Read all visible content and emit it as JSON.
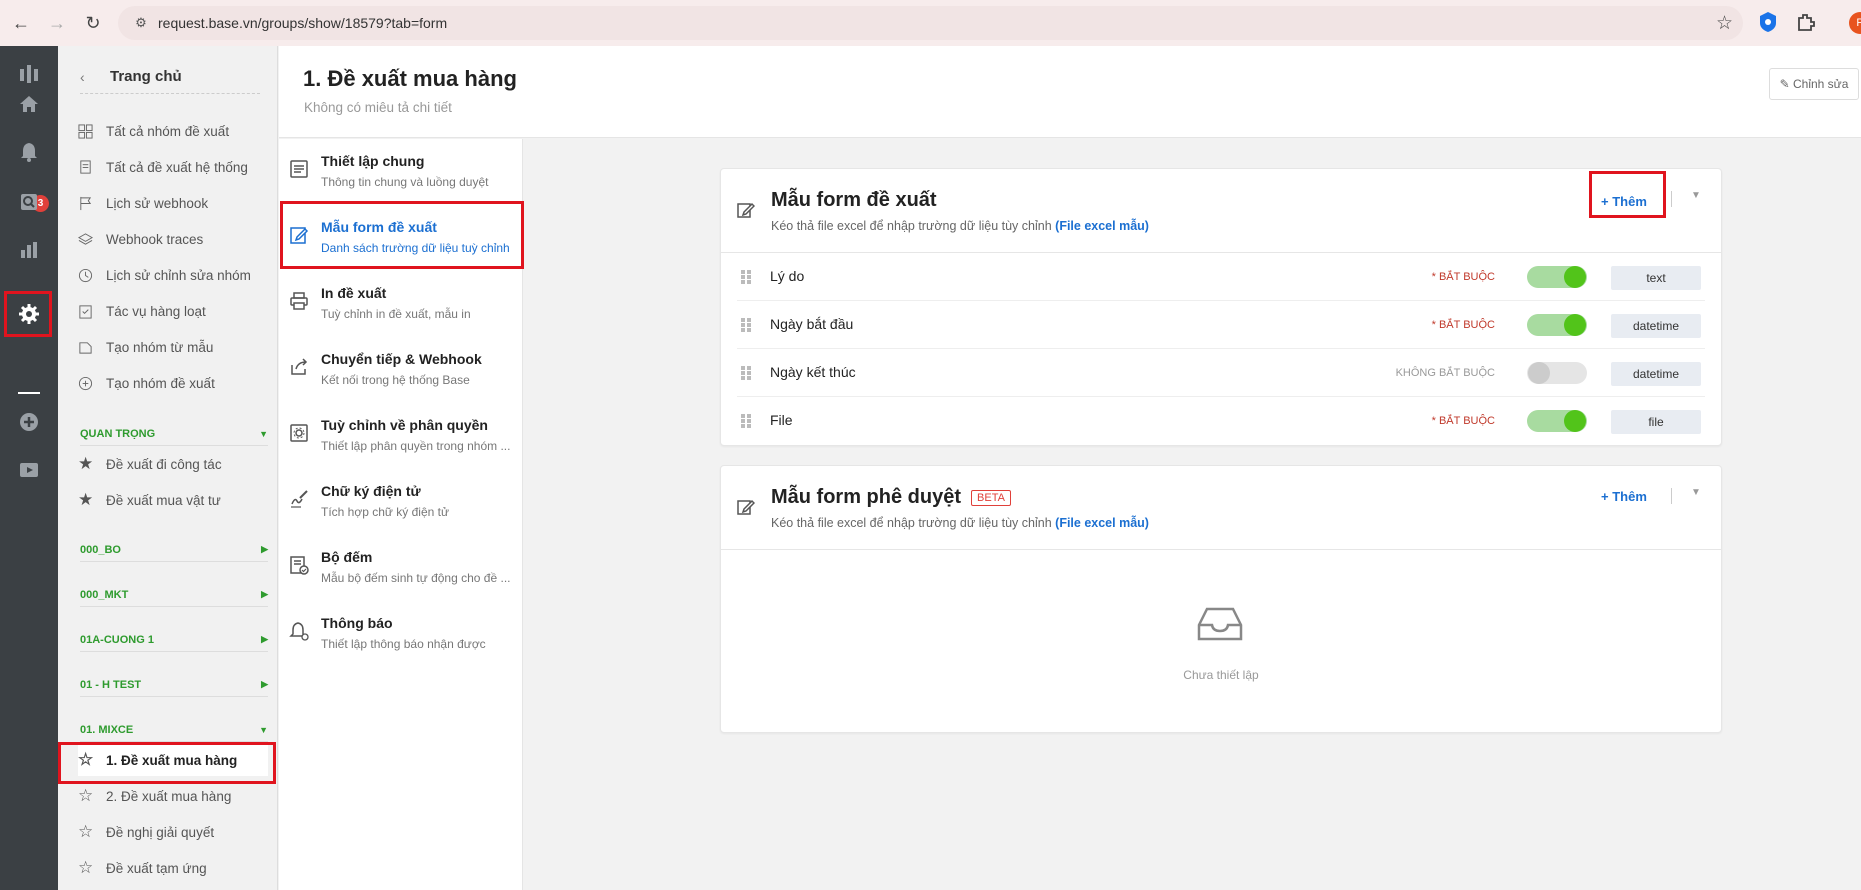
{
  "browser": {
    "url": "request.base.vn/groups/show/18579?tab=form",
    "profile_initial": "P"
  },
  "rail": {
    "notification_count": "3"
  },
  "sidebar": {
    "home_label": "Trang chủ",
    "items": [
      {
        "label": "Tất cả nhóm đề xuất",
        "icon": "grid-icon"
      },
      {
        "label": "Tất cả đề xuất hệ thống",
        "icon": "documents-icon"
      },
      {
        "label": "Lịch sử webhook",
        "icon": "flag-icon"
      },
      {
        "label": "Webhook traces",
        "icon": "layers-icon"
      },
      {
        "label": "Lịch sử chỉnh sửa nhóm",
        "icon": "clock-icon"
      },
      {
        "label": "Tác vụ hàng loạt",
        "icon": "checklist-icon"
      },
      {
        "label": "Tạo nhóm từ mẫu",
        "icon": "template-icon"
      },
      {
        "label": "Tạo nhóm đề xuất",
        "icon": "plus-circle-icon"
      }
    ],
    "sections": [
      {
        "label": "QUAN TRỌNG",
        "items": [
          "Đề xuất đi công tác",
          "Đề xuất mua vật tư"
        ]
      },
      {
        "label": "000_BO"
      },
      {
        "label": "000_MKT"
      },
      {
        "label": "01A-CUONG 1"
      },
      {
        "label": "01 - H TEST"
      },
      {
        "label": "01. MIXCE",
        "items": [
          "1. Đề xuất mua hàng",
          "2. Đề xuất mua hàng",
          "Đề nghị giải quyết",
          "Đề xuất tạm ứng"
        ]
      }
    ]
  },
  "header": {
    "title": "1. Đề xuất mua hàng",
    "subtitle": "Không có miêu tả chi tiết",
    "edit_label": "Chỉnh sửa"
  },
  "setnav": [
    {
      "title": "Thiết lập chung",
      "sub": "Thông tin chung và luồng duyệt",
      "icon": "document-lines-icon"
    },
    {
      "title": "Mẫu form đề xuất",
      "sub": "Danh sách trường dữ liệu tuỳ chỉnh",
      "icon": "edit-icon",
      "active": true
    },
    {
      "title": "In đề xuất",
      "sub": "Tuỳ chỉnh in đề xuất, mẫu in",
      "icon": "printer-icon"
    },
    {
      "title": "Chuyển tiếp & Webhook",
      "sub": "Kết nối trong hệ thống Base",
      "icon": "share-icon"
    },
    {
      "title": "Tuỳ chỉnh về phân quyền",
      "sub": "Thiết lập phân quyền trong nhóm ...",
      "icon": "settings-box-icon"
    },
    {
      "title": "Chữ ký điện tử",
      "sub": "Tích hợp chữ ký điện tử",
      "icon": "signature-icon"
    },
    {
      "title": "Bộ đếm",
      "sub": "Mẫu bộ đếm sinh tự động cho đề ...",
      "icon": "counter-icon"
    },
    {
      "title": "Thông báo",
      "sub": "Thiết lập thông báo nhận được",
      "icon": "bell-settings-icon"
    }
  ],
  "form_card": {
    "title": "Mẫu form đề xuất",
    "desc": "Kéo thả file excel để nhập trường dữ liệu tùy chỉnh",
    "link": "(File excel mẫu)",
    "add_label": "+ Thêm",
    "fields": [
      {
        "name": "Lý do",
        "required": "* BẮT BUỘC",
        "enabled": true,
        "type": "text"
      },
      {
        "name": "Ngày bắt đầu",
        "required": "* BẮT BUỘC",
        "enabled": true,
        "type": "datetime"
      },
      {
        "name": "Ngày kết thúc",
        "required": "KHÔNG BẮT BUỘC",
        "enabled": false,
        "type": "datetime"
      },
      {
        "name": "File",
        "required": "* BẮT BUỘC",
        "enabled": true,
        "type": "file"
      }
    ]
  },
  "approval_card": {
    "title": "Mẫu form phê duyệt",
    "badge": "BETA",
    "desc": "Kéo thả file excel để nhập trường dữ liệu tùy chỉnh",
    "link": "(File excel mẫu)",
    "add_label": "+ Thêm",
    "empty_text": "Chưa thiết lập"
  },
  "colors": {
    "accent": "#1b6fd1",
    "highlight": "#e0141e",
    "section_green": "#2e9b2e",
    "toggle_on": "#52c41a"
  }
}
